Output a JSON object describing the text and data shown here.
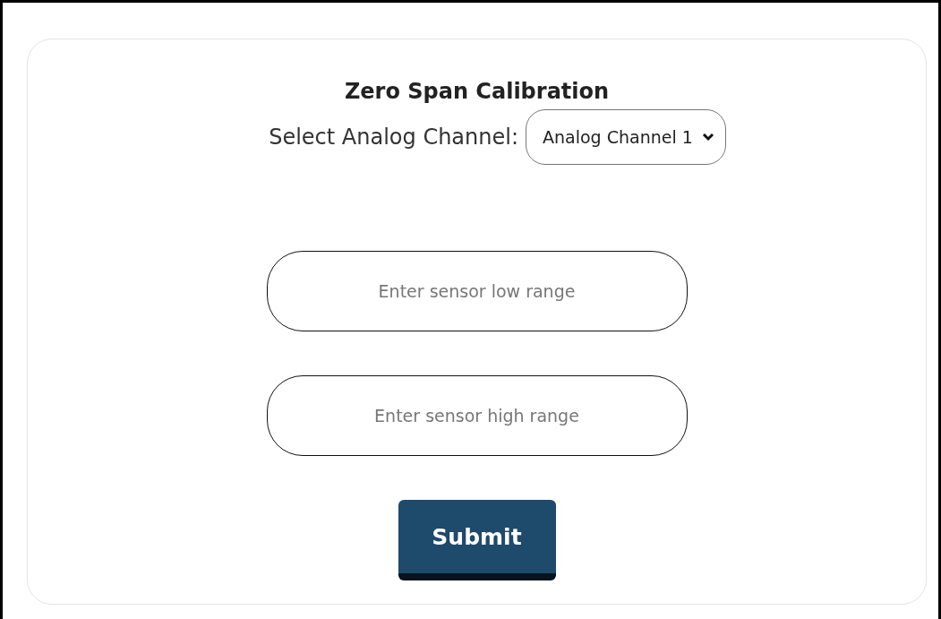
{
  "title": "Zero Span Calibration",
  "channel_select": {
    "label": "Select Analog Channel:",
    "value": "Analog Channel 1"
  },
  "fields": [
    {
      "placeholder": "Enter sensor low range"
    },
    {
      "placeholder": "Enter sensor high range"
    }
  ],
  "submit_button": "Submit"
}
